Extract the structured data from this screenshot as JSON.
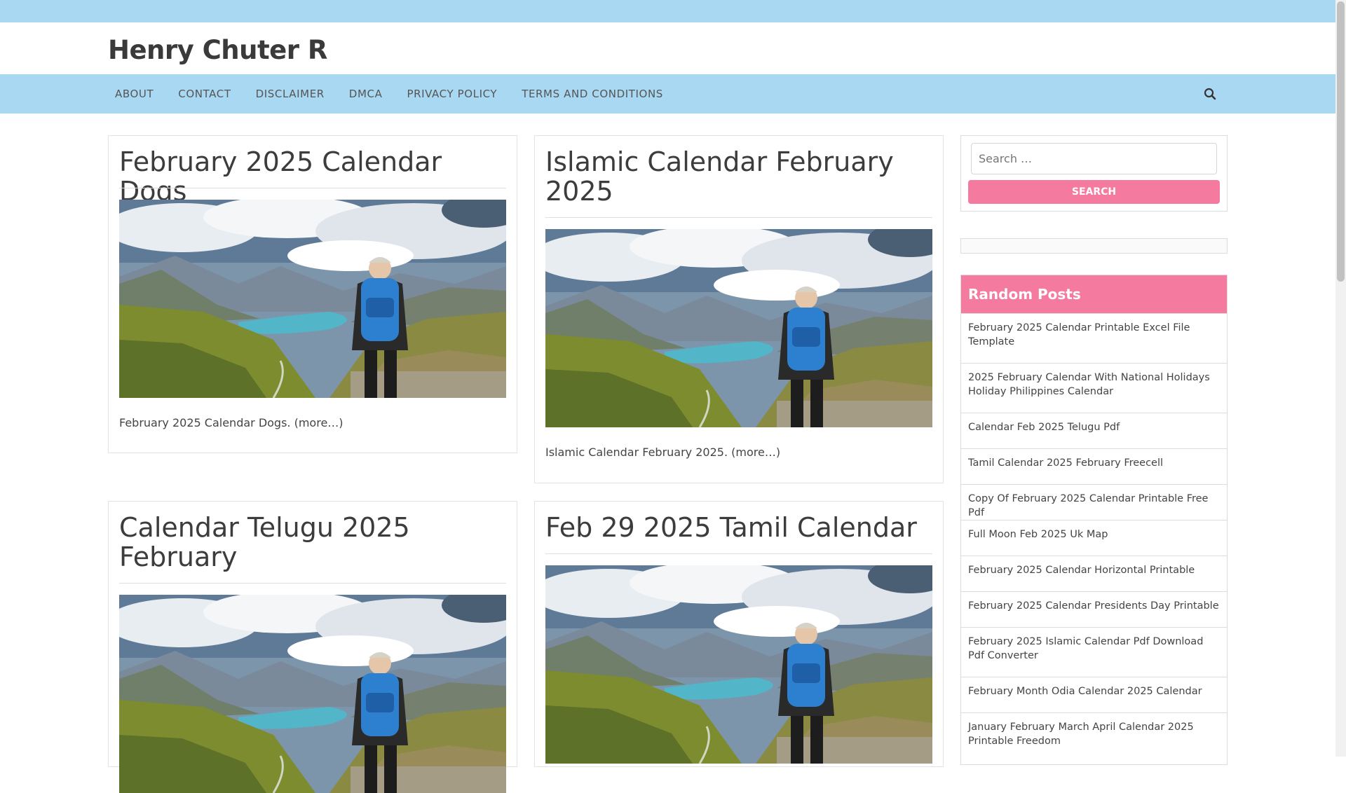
{
  "site": {
    "title": "Henry Chuter R"
  },
  "nav": {
    "items": [
      "ABOUT",
      "CONTACT",
      "DISCLAIMER",
      "DMCA",
      "PRIVACY POLICY",
      "TERMS AND CONDITIONS"
    ]
  },
  "posts": [
    {
      "title": "February 2025 Calendar Dogs",
      "excerpt": "February 2025 Calendar Dogs. (more…)"
    },
    {
      "title": "Islamic Calendar February 2025",
      "excerpt": "Islamic Calendar February 2025. (more…)"
    },
    {
      "title": "Calendar Telugu 2025 February",
      "excerpt": ""
    },
    {
      "title": "Feb 29 2025 Tamil Calendar",
      "excerpt": ""
    }
  ],
  "sidebar": {
    "search": {
      "placeholder": "Search …",
      "button": "SEARCH"
    },
    "random": {
      "heading": "Random Posts",
      "items": [
        "February 2025 Calendar Printable Excel File Template",
        "2025 February Calendar With National Holidays Holiday Philippines Calendar",
        "Calendar Feb 2025 Telugu Pdf",
        "Tamil Calendar 2025 February Freecell",
        "Copy Of February 2025 Calendar Printable Free Pdf",
        "Full Moon Feb 2025 Uk Map",
        "February 2025 Calendar Horizontal Printable",
        "February 2025 Calendar Presidents Day Printable",
        "February 2025 Islamic Calendar Pdf Download Pdf Converter",
        "February Month Odia Calendar 2025 Calendar",
        "January February March April Calendar 2025 Printable Freedom"
      ]
    }
  },
  "colors": {
    "accent_blue": "#a9d8f2",
    "accent_pink": "#f47aa0"
  }
}
